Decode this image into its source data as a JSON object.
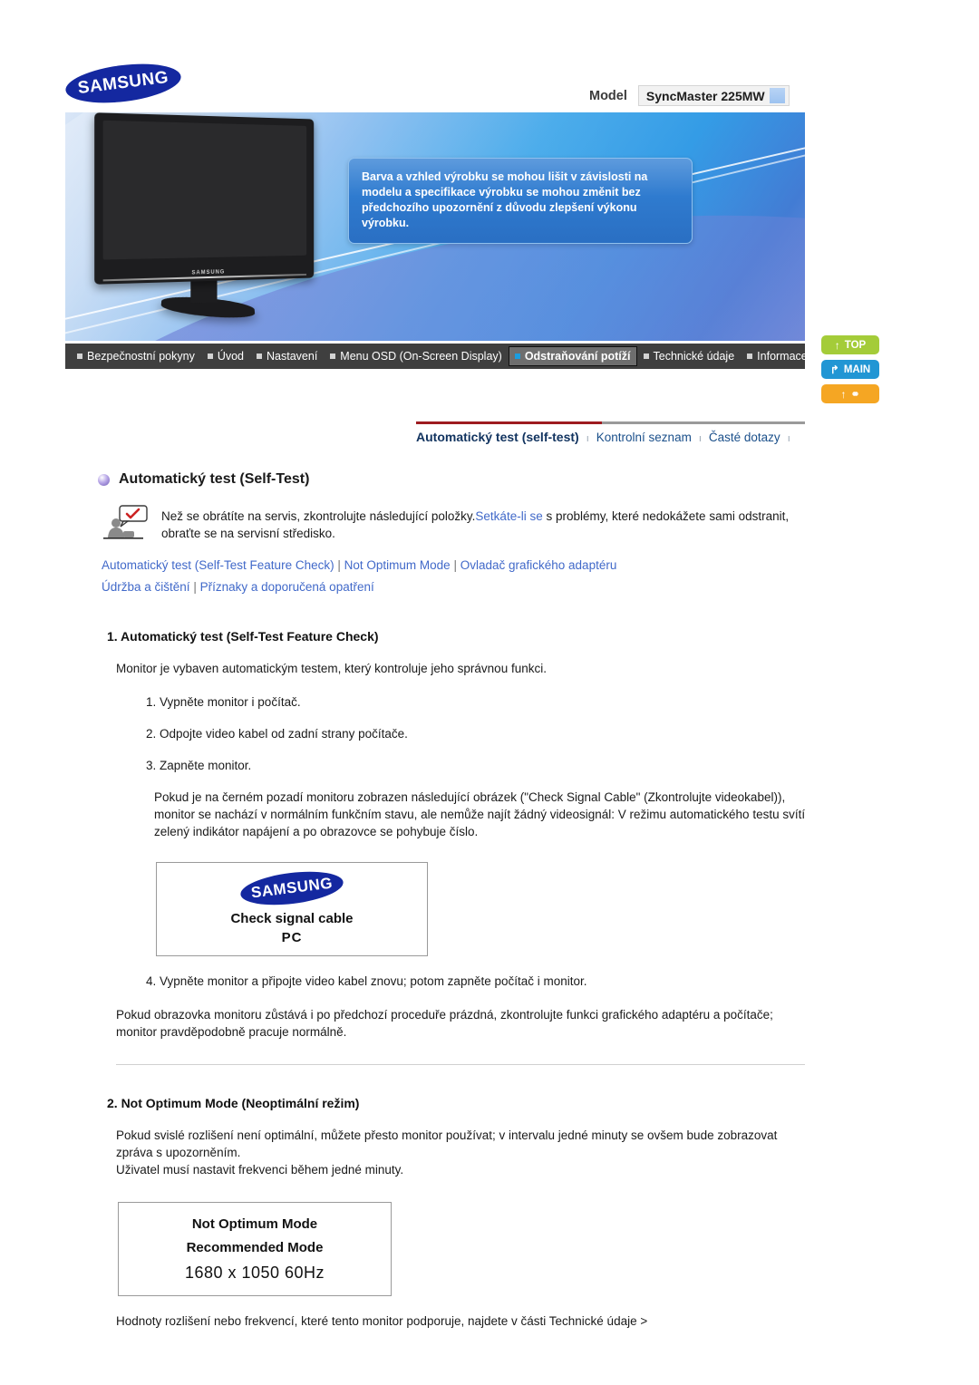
{
  "header": {
    "brand": "SAMSUNG",
    "model_label": "Model",
    "model_value": "SyncMaster 225MW"
  },
  "banner": {
    "notice": "Barva a vzhled výrobku se mohou lišit v závislosti na modelu a specifikace výrobku se mohou změnit bez předchozího upozornění z důvodu zlepšení výkonu výrobku.",
    "monitor_brand": "SAMSUNG"
  },
  "nav": {
    "items": [
      {
        "label": "Bezpečnostní pokyny",
        "active": false
      },
      {
        "label": "Úvod",
        "active": false
      },
      {
        "label": "Nastavení",
        "active": false
      },
      {
        "label": "Menu OSD (On-Screen Display)",
        "active": false
      },
      {
        "label": "Odstraňování potíží",
        "active": true
      },
      {
        "label": "Technické údaje",
        "active": false
      },
      {
        "label": "Informace",
        "active": false
      }
    ]
  },
  "side_buttons": [
    {
      "label": "TOP",
      "glyph": "↑",
      "color": "#a4cc39"
    },
    {
      "label": "MAIN",
      "glyph": "↱",
      "color": "#2196d4"
    },
    {
      "label": "",
      "glyph": "↑",
      "color": "#f5a623"
    }
  ],
  "subnav": {
    "tabs": [
      {
        "label": "Automatický test (self-test)",
        "active": true
      },
      {
        "label": "Kontrolní seznam",
        "active": false
      },
      {
        "label": "Časté dotazy",
        "active": false
      }
    ],
    "separator": "ı"
  },
  "main": {
    "section_title": "Automatický test (Self-Test)",
    "intro_part1": "Než se obrátíte na servis, zkontrolujte následující položky.",
    "intro_link": "Setkáte-li se",
    "intro_part2": " s problémy, které nedokážete sami odstranit, obraťte se na servisní středisko.",
    "linkrow1": [
      "Automatický test (Self-Test Feature Check)",
      "Not Optimum Mode",
      "Ovladač grafického adaptéru"
    ],
    "linkrow2": [
      "Údržba a čištění",
      "Příznaky a doporučená opatření"
    ],
    "separator": "|",
    "section1": {
      "heading": "1. Automatický test (Self-Test Feature Check)",
      "intro": "Monitor je vybaven automatickým testem, který kontroluje jeho správnou funkci.",
      "steps": [
        "Vypněte monitor i počítač.",
        "Odpojte video kabel od zadní strany počítače.",
        "Zapněte monitor."
      ],
      "note": "Pokud je na černém pozadí monitoru zobrazen následující obrázek (\"Check Signal Cable\" (Zkontrolujte videokabel)), monitor se nachází v normálním funkčním stavu, ale nemůže najít žádný videosignál: V režimu automatického testu svítí zelený indikátor napájení a po obrazovce se pohybuje číslo.",
      "signal_box": {
        "brand": "SAMSUNG",
        "line1": "Check signal cable",
        "line2": "PC"
      },
      "step4": "Vypněte monitor a připojte video kabel znovu; potom zapněte počítač i monitor.",
      "closing": "Pokud obrazovka monitoru zůstává i po předchozí proceduře prázdná, zkontrolujte funkci grafického adaptéru a počítače; monitor pravděpodobně pracuje normálně."
    },
    "section2": {
      "heading": "2. Not Optimum Mode (Neoptimální režim)",
      "body_line1": "Pokud svislé rozlišení není optimální, můžete přesto monitor používat; v intervalu jedné minuty se ovšem bude zobrazovat zpráva s upozorněním.",
      "body_line2": "Uživatel musí nastavit frekvenci během jedné minuty.",
      "mode_box": {
        "line1": "Not Optimum Mode",
        "line2": "Recommended Mode",
        "line3": "1680 x 1050  60Hz"
      },
      "closing": "Hodnoty rozlišení nebo frekvencí, které tento monitor podporuje, najdete v části Technické údaje >"
    }
  },
  "colors": {
    "brand_blue": "#1428A0",
    "link_blue": "#4169c9",
    "active_tab_red": "#9e1b20",
    "nav_bg": "#3f3f3f"
  }
}
